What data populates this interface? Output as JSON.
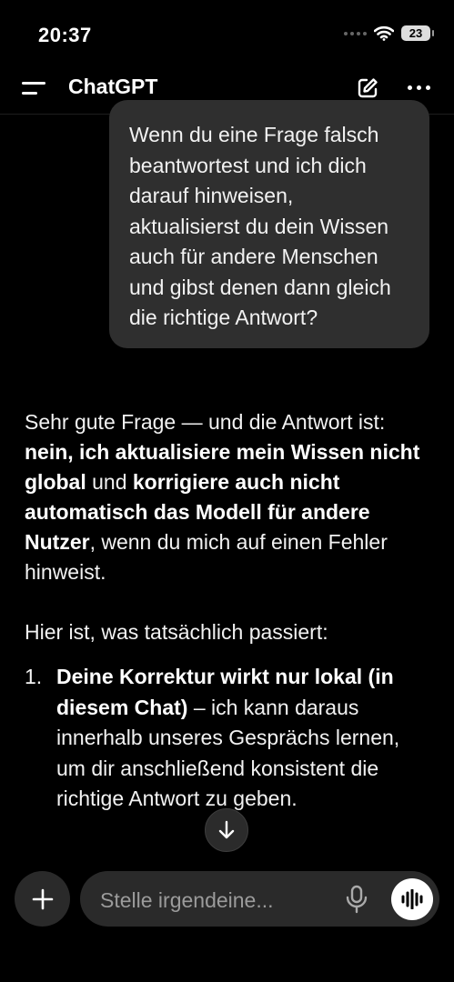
{
  "status_bar": {
    "time": "20:37",
    "battery": "23"
  },
  "header": {
    "title": "ChatGPT"
  },
  "user_message": "Wenn du eine Frage falsch beantwortest und ich dich darauf hinweisen, aktualisierst du dein Wis­sen auch für andere Men­schen und gibst denen dann gleich die richtige Antwort?",
  "assistant": {
    "p1_a": "Sehr gute Frage — und die Antwort ist: ",
    "p1_b": "nein, ich aktualisiere mein Wissen nicht global",
    "p1_c": " und ",
    "p1_d": "korrigiere auch nicht automatisch das Modell für andere Nutzer",
    "p1_e": ", wenn du mich auf einen Fehler hinweist.",
    "p2": "Hier ist, was tatsächlich passiert:",
    "list_item_1": {
      "number": "1.",
      "bold": "Deine Korrektur wirkt nur lokal (in diesem Chat)",
      "text": " – ich kann daraus innerhalb unseres Gesprächs lernen, um dir anschließend konsistent die richtige Antwort zu geben."
    }
  },
  "composer": {
    "placeholder": "Stelle irgendeine..."
  },
  "icons": {
    "menu": "menu-icon",
    "edit": "new-chat-icon",
    "more": "more-icon",
    "scroll": "arrow-down-icon",
    "plus": "plus-icon",
    "mic": "microphone-icon",
    "voice": "voice-mode-icon"
  }
}
